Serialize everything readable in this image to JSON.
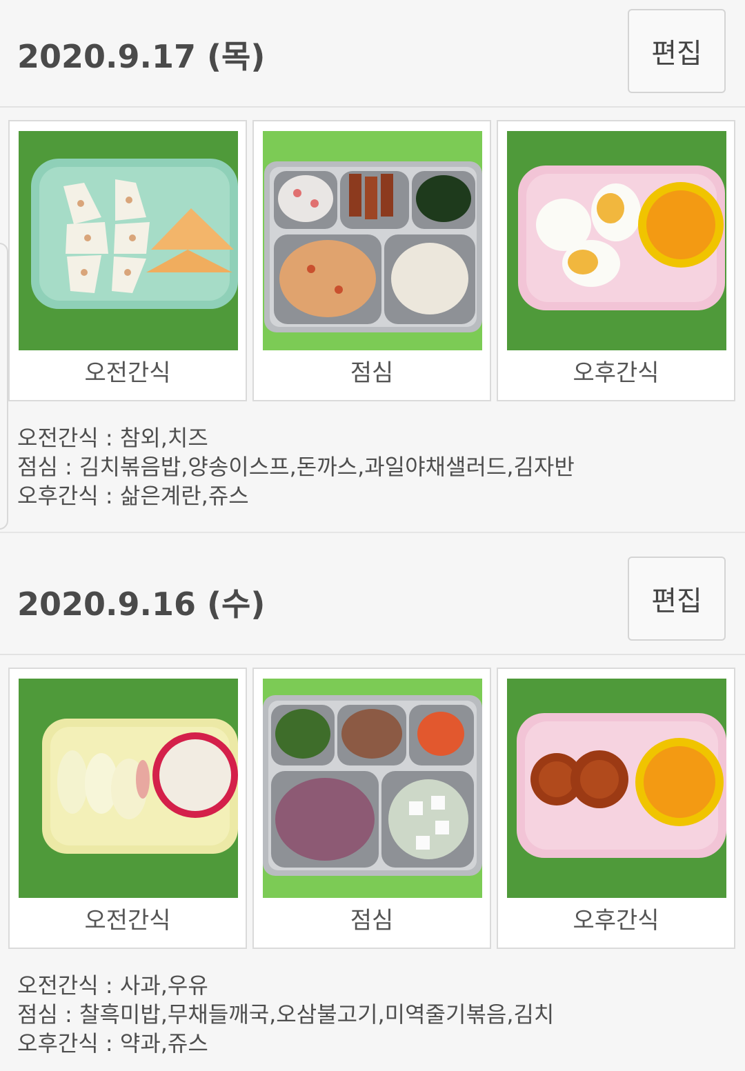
{
  "days": [
    {
      "title": "2020.9.17 (목)",
      "edit_label": "편집",
      "photos": [
        {
          "label": "오전간식",
          "image": "참외 치즈 접시"
        },
        {
          "label": "점심",
          "image": "급식판 김치볶음밥"
        },
        {
          "label": "오후간식",
          "image": "삶은계란 쥬스 접시"
        }
      ],
      "menu": [
        "오전간식 : 참외,치즈",
        "점심 : 김치볶음밥,양송이스프,돈까스,과일야채샐러드,김자반",
        "오후간식 : 삶은계란,쥬스"
      ]
    },
    {
      "title": "2020.9.16 (수)",
      "edit_label": "편집",
      "photos": [
        {
          "label": "오전간식",
          "image": "사과 우유 접시"
        },
        {
          "label": "점심",
          "image": "급식판 찰흑미밥"
        },
        {
          "label": "오후간식",
          "image": "약과 쥬스 접시"
        }
      ],
      "menu": [
        "오전간식 : 사과,우유",
        "점심 : 찰흑미밥,무채들깨국,오삼불고기,미역줄기볶음,김치",
        "오후간식 : 약과,쥬스"
      ]
    }
  ],
  "colors": {
    "background": "#f6f6f6",
    "table_green": "#5aa83a",
    "card_border": "#dadada"
  }
}
